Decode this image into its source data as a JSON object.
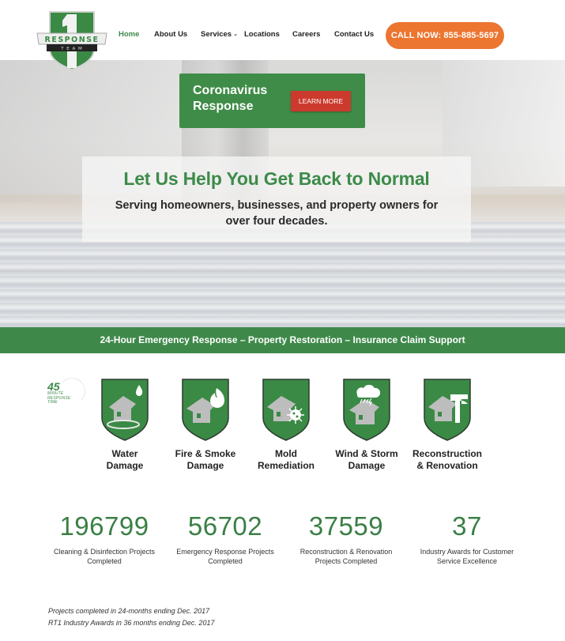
{
  "header": {
    "logo": {
      "top_text": "RESPONSE",
      "bottom_text": "T E A M",
      "numeral": "1"
    },
    "nav": [
      {
        "label": "Home",
        "active": true
      },
      {
        "label": "About Us",
        "active": false
      },
      {
        "label": "Services",
        "active": false,
        "has_dropdown": true,
        "dropdown_icon": "chevron-down-icon"
      },
      {
        "label": "Locations",
        "active": false
      },
      {
        "label": "Careers",
        "active": false
      },
      {
        "label": "Contact Us",
        "active": false
      }
    ],
    "call_button": "CALL NOW: 855-885-5697"
  },
  "hero": {
    "alert": {
      "title": "Coronavirus Response",
      "button": "LEARN MORE"
    },
    "headline": "Let Us Help You Get Back to Normal",
    "subheadline": "Serving homeowners, businesses, and property owners for over four decades."
  },
  "banner": {
    "text": "24-Hour Emergency Response – Property Restoration – Insurance Claim Support"
  },
  "response_badge": {
    "number": "45",
    "lines": [
      "MINUTE",
      "RESPONSE",
      "TIME"
    ]
  },
  "services": [
    {
      "label_line1": "Water",
      "label_line2": "Damage",
      "icon": "water-drop-icon"
    },
    {
      "label_line1": "Fire & Smoke",
      "label_line2": "Damage",
      "icon": "fire-icon"
    },
    {
      "label_line1": "Mold",
      "label_line2": "Remediation",
      "icon": "mold-spore-icon"
    },
    {
      "label_line1": "Wind & Storm",
      "label_line2": "Damage",
      "icon": "storm-cloud-icon"
    },
    {
      "label_line1": "Reconstruction",
      "label_line2": "& Renovation",
      "icon": "hammer-icon"
    }
  ],
  "stats": [
    {
      "value": "196799",
      "caption_line1": "Cleaning & Disinfection Projects",
      "caption_line2": "Completed"
    },
    {
      "value": "56702",
      "caption_line1": "Emergency Response Projects",
      "caption_line2": "Completed"
    },
    {
      "value": "37559",
      "caption_line1": "Reconstruction & Renovation",
      "caption_line2": "Projects Completed"
    },
    {
      "value": "37",
      "caption_line1": "Industry Awards for Customer",
      "caption_line2": "Service Excellence"
    }
  ],
  "footnotes": [
    "Projects completed in 24-months ending Dec. 2017",
    "RT1 Industry Awards in 36 months ending Dec. 2017"
  ],
  "colors": {
    "brand_green": "#3e894a",
    "call_orange": "#ec7530",
    "learn_red": "#cc3a2e"
  }
}
